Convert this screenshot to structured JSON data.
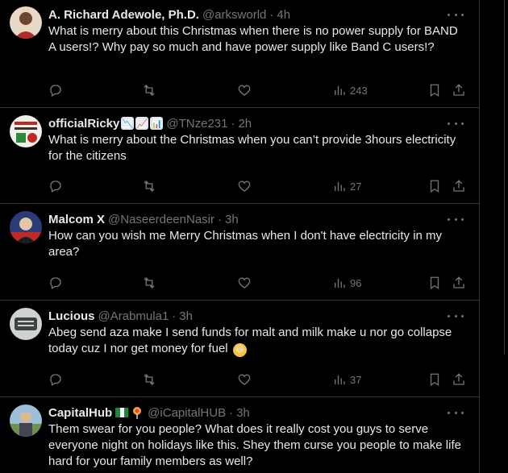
{
  "tweets": [
    {
      "name": "A. Richard Adewole, Ph.D.",
      "handle": "@arksworld",
      "time": "4h",
      "text": "What is merry about this Christmas when there is no power supply for BAND A users!? Why pay so much and have power supply like Band C users!?",
      "views": "243",
      "avatar_color": "#c9a07a"
    },
    {
      "name": "officialRicky",
      "handle": "@TNze231",
      "time": "2h",
      "text": "What is merry about the Christmas when you can’t provide 3hours electricity for the citizens",
      "views": "27",
      "avatar_color": "#e8e0d8"
    },
    {
      "name": "Malcom X",
      "handle": "@NaseerdeenNasir",
      "time": "3h",
      "text": "How can you wish me Merry Christmas when I don't have electricity in my area?",
      "views": "96",
      "avatar_color": "#3b4a8a"
    },
    {
      "name": "Lucious",
      "handle": "@Arabmula1",
      "time": "3h",
      "text": "Abeg send aza make I send funds for malt and milk make u nor go collapse today cuz I nor get money for fuel",
      "views": "37",
      "avatar_color": "#7a7f7a"
    },
    {
      "name": "CapitalHub",
      "handle": "@iCapitalHUB",
      "time": "3h",
      "text": "Them swear for you people? What does it really cost you guys to serve everyone night on holidays like this. Shey them curse you people to make life hard for your family members as well?",
      "avatar_color": "#8fb0c8"
    }
  ],
  "emojis": {
    "ricky": [
      "📉",
      "📈",
      "📊"
    ],
    "lucious_end": "😆",
    "capitalhub": [
      "🇳🇬",
      "🍭"
    ]
  },
  "colors": {
    "background": "#000000",
    "text": "#e7e9ea",
    "muted": "#71767b",
    "border": "#2f3336"
  }
}
